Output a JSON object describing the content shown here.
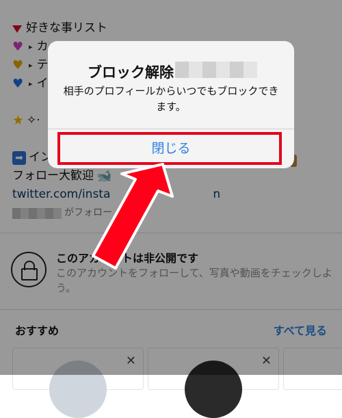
{
  "bio": {
    "line1": "好きな事リスト",
    "line2": "カ",
    "line3": "テ",
    "line4": "イ",
    "line5": "✧·",
    "line6": "イン",
    "line7": "フォロー大歓迎",
    "line8": "twitter.com/insta",
    "line8_tail": "n",
    "line9": "がフォロー"
  },
  "private": {
    "title": "このアカウントは非公開です",
    "desc": "このアカウントをフォローして、写真や動画をチェックしよう。"
  },
  "suggestions": {
    "heading": "おすすめ",
    "see_all": "すべて見る",
    "close_glyph": "✕"
  },
  "dialog": {
    "title": "ブロック解除",
    "message": "相手のプロフィールからいつでもブロックできます。",
    "button": "閉じる"
  },
  "colors": {
    "accent": "#2b7fe0",
    "highlight": "#e5001c"
  },
  "icons": {
    "private": "lock-icon",
    "annotation": "red-arrow-icon"
  }
}
